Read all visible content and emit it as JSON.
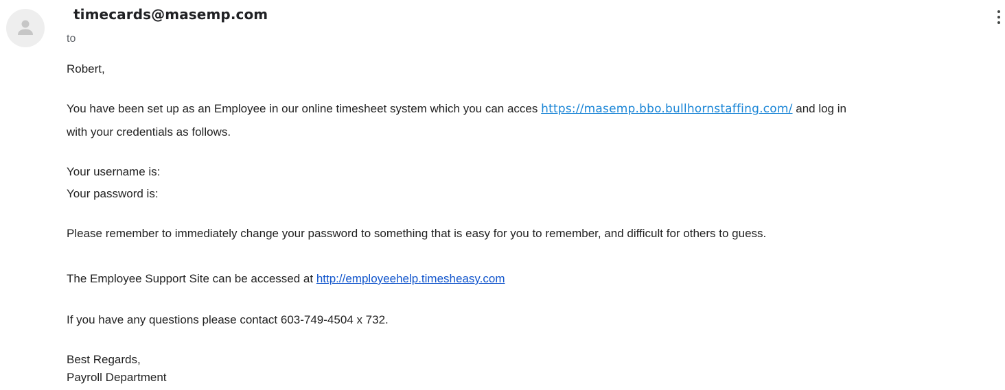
{
  "header": {
    "sender": "timecards@masemp.com",
    "recipient_label": "to",
    "avatar_icon": "person-icon",
    "more_icon": "more-vert-icon"
  },
  "message": {
    "greeting": "Robert,",
    "intro_before_link": "You have been set up as an Employee in our online timesheet system which you can acces",
    "system_link": "https://masemp.bbo.bullhornstaffing.com/",
    "intro_after_link": " and log in",
    "intro_line2": "with your credentials as follows.",
    "username_label": "Your username is:",
    "password_label": "Your password is:",
    "password_reminder": "Please remember to immediately change your password to something that is easy for you to remember, and difficult for others to guess.",
    "support_before_link": "The Employee Support Site can be accessed at ",
    "support_link": "http://employeehelp.timesheasy.com",
    "questions": "If you have any questions please contact 603-749-4504 x 732.",
    "closing": "Best Regards,",
    "signature": "Payroll Department"
  },
  "colors": {
    "link": "#1a73e8",
    "avatar_bg": "#eeeeee",
    "avatar_fg": "#c6c6c6"
  }
}
